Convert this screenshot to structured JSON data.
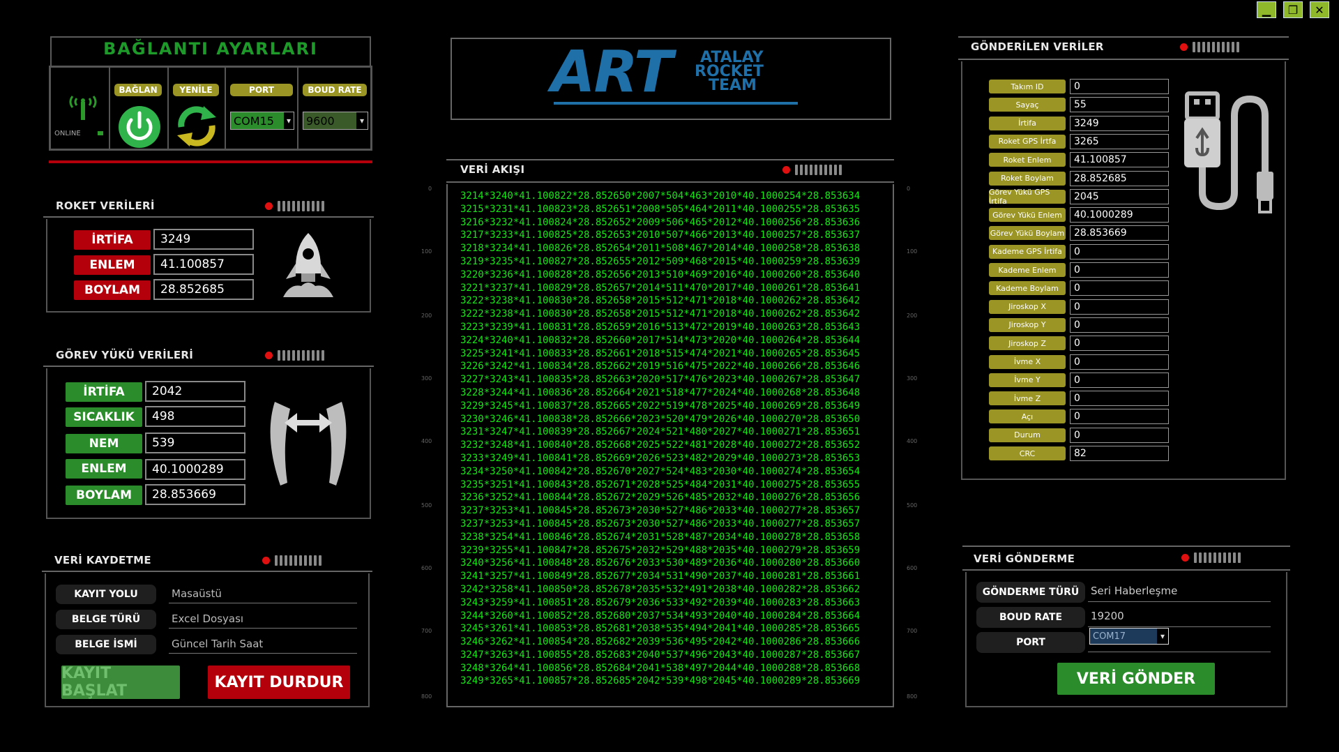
{
  "window_controls": {
    "minimize": "▁",
    "restore": "❐",
    "close": "✕"
  },
  "connection": {
    "title": "BAĞLANTI AYARLARI",
    "status": "ONLINE",
    "connect_label": "BAĞLAN",
    "refresh_label": "YENİLE",
    "port_label": "PORT",
    "baud_label": "BOUD RATE",
    "port_value": "COM15",
    "baud_value": "9600"
  },
  "logo": {
    "art": "ART",
    "line1": "ATALAY",
    "line2": "ROCKET",
    "line3": "TEAM"
  },
  "rocket": {
    "title": "ROKET VERİLERİ",
    "rows": [
      {
        "label": "İRTİFA",
        "value": "3249"
      },
      {
        "label": "ENLEM",
        "value": "41.100857"
      },
      {
        "label": "BOYLAM",
        "value": "28.852685"
      }
    ]
  },
  "payload": {
    "title": "GÖREV YÜKÜ VERİLERİ",
    "rows": [
      {
        "label": "İRTİFA",
        "value": "2042"
      },
      {
        "label": "SICAKLIK",
        "value": "498"
      },
      {
        "label": "NEM",
        "value": "539"
      },
      {
        "label": "ENLEM",
        "value": "40.1000289"
      },
      {
        "label": "BOYLAM",
        "value": "28.853669"
      }
    ]
  },
  "record": {
    "title": "VERİ KAYDETME",
    "rows": [
      {
        "label": "KAYIT YOLU",
        "value": "Masaüstü"
      },
      {
        "label": "BELGE TÜRÜ",
        "value": "Excel Dosyası"
      },
      {
        "label": "BELGE İSMİ",
        "value": "Güncel Tarih Saat"
      }
    ],
    "start_label": "KAYIT BAŞLAT",
    "stop_label": "KAYIT DURDUR"
  },
  "stream": {
    "title": "VERİ AKIŞI",
    "ticks": [
      "0",
      "100",
      "200",
      "300",
      "400",
      "500",
      "600",
      "700",
      "800"
    ],
    "lines": [
      "3214*3240*41.100822*28.852650*2007*504*463*2010*40.1000254*28.853634",
      "3215*3231*41.100823*28.852651*2008*505*464*2011*40.1000255*28.853635",
      "3216*3232*41.100824*28.852652*2009*506*465*2012*40.1000256*28.853636",
      "3217*3233*41.100825*28.852653*2010*507*466*2013*40.1000257*28.853637",
      "3218*3234*41.100826*28.852654*2011*508*467*2014*40.1000258*28.853638",
      "3219*3235*41.100827*28.852655*2012*509*468*2015*40.1000259*28.853639",
      "3220*3236*41.100828*28.852656*2013*510*469*2016*40.1000260*28.853640",
      "3221*3237*41.100829*28.852657*2014*511*470*2017*40.1000261*28.853641",
      "3222*3238*41.100830*28.852658*2015*512*471*2018*40.1000262*28.853642",
      "3222*3238*41.100830*28.852658*2015*512*471*2018*40.1000262*28.853642",
      "3223*3239*41.100831*28.852659*2016*513*472*2019*40.1000263*28.853643",
      "3224*3240*41.100832*28.852660*2017*514*473*2020*40.1000264*28.853644",
      "3225*3241*41.100833*28.852661*2018*515*474*2021*40.1000265*28.853645",
      "3226*3242*41.100834*28.852662*2019*516*475*2022*40.1000266*28.853646",
      "3227*3243*41.100835*28.852663*2020*517*476*2023*40.1000267*28.853647",
      "3228*3244*41.100836*28.852664*2021*518*477*2024*40.1000268*28.853648",
      "3229*3245*41.100837*28.852665*2022*519*478*2025*40.1000269*28.853649",
      "3230*3246*41.100838*28.852666*2023*520*479*2026*40.1000270*28.853650",
      "3231*3247*41.100839*28.852667*2024*521*480*2027*40.1000271*28.853651",
      "3232*3248*41.100840*28.852668*2025*522*481*2028*40.1000272*28.853652",
      "3233*3249*41.100841*28.852669*2026*523*482*2029*40.1000273*28.853653",
      "3234*3250*41.100842*28.852670*2027*524*483*2030*40.1000274*28.853654",
      "3235*3251*41.100843*28.852671*2028*525*484*2031*40.1000275*28.853655",
      "3236*3252*41.100844*28.852672*2029*526*485*2032*40.1000276*28.853656",
      "3237*3253*41.100845*28.852673*2030*527*486*2033*40.1000277*28.853657",
      "3237*3253*41.100845*28.852673*2030*527*486*2033*40.1000277*28.853657",
      "3238*3254*41.100846*28.852674*2031*528*487*2034*40.1000278*28.853658",
      "3239*3255*41.100847*28.852675*2032*529*488*2035*40.1000279*28.853659",
      "3240*3256*41.100848*28.852676*2033*530*489*2036*40.1000280*28.853660",
      "3241*3257*41.100849*28.852677*2034*531*490*2037*40.1000281*28.853661",
      "3242*3258*41.100850*28.852678*2035*532*491*2038*40.1000282*28.853662",
      "3243*3259*41.100851*28.852679*2036*533*492*2039*40.1000283*28.853663",
      "3244*3260*41.100852*28.852680*2037*534*493*2040*40.1000284*28.853664",
      "3245*3261*41.100853*28.852681*2038*535*494*2041*40.1000285*28.853665",
      "3246*3262*41.100854*28.852682*2039*536*495*2042*40.1000286*28.853666",
      "3247*3263*41.100855*28.852683*2040*537*496*2043*40.1000287*28.853667",
      "3248*3264*41.100856*28.852684*2041*538*497*2044*40.1000288*28.853668",
      "3249*3265*41.100857*28.852685*2042*539*498*2045*40.1000289*28.853669"
    ]
  },
  "sent": {
    "title": "GÖNDERİLEN VERİLER",
    "rows": [
      {
        "label": "Takım ID",
        "value": "0"
      },
      {
        "label": "Sayaç",
        "value": "55"
      },
      {
        "label": "İrtifa",
        "value": "3249"
      },
      {
        "label": "Roket GPS İrtfa",
        "value": "3265"
      },
      {
        "label": "Roket Enlem",
        "value": "41.100857"
      },
      {
        "label": "Roket Boylam",
        "value": "28.852685"
      },
      {
        "label": "Görev Yükü GPS İrtifa",
        "value": "2045"
      },
      {
        "label": "Görev Yükü Enlem",
        "value": "40.1000289"
      },
      {
        "label": "Görev Yükü Boylam",
        "value": "28.853669"
      },
      {
        "label": "Kademe GPS İrtifa",
        "value": "0"
      },
      {
        "label": "Kademe Enlem",
        "value": "0"
      },
      {
        "label": "Kademe Boylam",
        "value": "0"
      },
      {
        "label": "Jiroskop X",
        "value": "0"
      },
      {
        "label": "Jiroskop Y",
        "value": "0"
      },
      {
        "label": "Jiroskop Z",
        "value": "0"
      },
      {
        "label": "İvme X",
        "value": "0"
      },
      {
        "label": "İvme Y",
        "value": "0"
      },
      {
        "label": "İvme Z",
        "value": "0"
      },
      {
        "label": "Açı",
        "value": "0"
      },
      {
        "label": "Durum",
        "value": "0"
      },
      {
        "label": "CRC",
        "value": "82"
      }
    ]
  },
  "send": {
    "title": "VERİ GÖNDERME",
    "rows": [
      {
        "label": "GÖNDERME TÜRÜ",
        "value": "Seri Haberleşme"
      },
      {
        "label": "BOUD RATE",
        "value": "19200"
      },
      {
        "label": "PORT",
        "value": ""
      }
    ],
    "port_value": "COM17",
    "button_label": "VERİ GÖNDER"
  },
  "colors": {
    "accent_green": "#17e617",
    "label_red": "#b3000b",
    "label_green": "#2b8c2b",
    "olive": "#9a9524",
    "logo_blue": "#1f6fa8"
  }
}
